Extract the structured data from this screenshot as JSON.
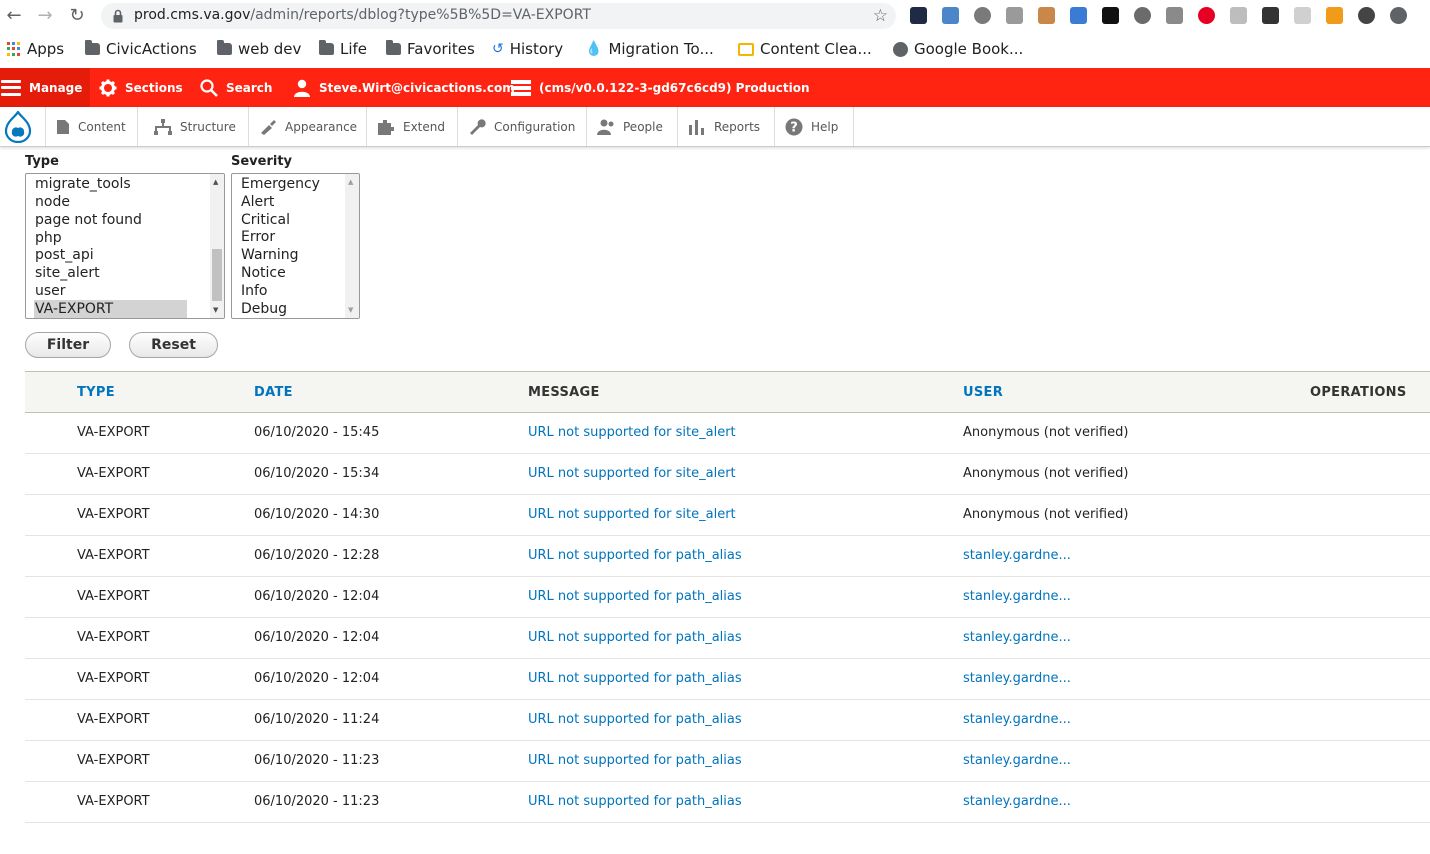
{
  "browser": {
    "url_host": "prod.cms.va.gov",
    "url_path": "/admin/reports/dblog?type%5B%5D=VA-EXPORT",
    "bookmarks": [
      {
        "label": "Apps",
        "icon": "apps-grid-icon"
      },
      {
        "label": "CivicActions",
        "icon": "folder-icon"
      },
      {
        "label": "web dev",
        "icon": "folder-icon"
      },
      {
        "label": "Life",
        "icon": "folder-icon"
      },
      {
        "label": "Favorites",
        "icon": "folder-icon"
      },
      {
        "label": "History",
        "icon": "history-icon"
      },
      {
        "label": "Migration To...",
        "icon": "drupal-drop-icon"
      },
      {
        "label": "Content Clea...",
        "icon": "slides-icon"
      },
      {
        "label": "Google Book...",
        "icon": "globe-icon"
      }
    ]
  },
  "toolbar": {
    "manage": "Manage",
    "sections": "Sections",
    "search": "Search",
    "user": "Steve.Wirt@civicactions.com",
    "environment": "(cms/v0.0.122-3-gd67c6cd9) Production"
  },
  "tray": {
    "items": [
      "Content",
      "Structure",
      "Appearance",
      "Extend",
      "Configuration",
      "People",
      "Reports",
      "Help"
    ]
  },
  "filters": {
    "type_label": "Type",
    "type_options": [
      "migrate_tools",
      "node",
      "page not found",
      "php",
      "post_api",
      "site_alert",
      "user",
      "VA-EXPORT"
    ],
    "type_selected": "VA-EXPORT",
    "severity_label": "Severity",
    "severity_options": [
      "Emergency",
      "Alert",
      "Critical",
      "Error",
      "Warning",
      "Notice",
      "Info",
      "Debug"
    ],
    "filter_button": "Filter",
    "reset_button": "Reset"
  },
  "table": {
    "headers": {
      "type": "TYPE",
      "date": "DATE",
      "message": "MESSAGE",
      "user": "USER",
      "operations": "OPERATIONS"
    },
    "rows": [
      {
        "type": "VA-EXPORT",
        "date": "06/10/2020 - 15:45",
        "message": "URL not supported for site_alert",
        "user": "Anonymous (not verified)",
        "user_link": false
      },
      {
        "type": "VA-EXPORT",
        "date": "06/10/2020 - 15:34",
        "message": "URL not supported for site_alert",
        "user": "Anonymous (not verified)",
        "user_link": false
      },
      {
        "type": "VA-EXPORT",
        "date": "06/10/2020 - 14:30",
        "message": "URL not supported for site_alert",
        "user": "Anonymous (not verified)",
        "user_link": false
      },
      {
        "type": "VA-EXPORT",
        "date": "06/10/2020 - 12:28",
        "message": "URL not supported for path_alias",
        "user": "stanley.gardne...",
        "user_link": true
      },
      {
        "type": "VA-EXPORT",
        "date": "06/10/2020 - 12:04",
        "message": "URL not supported for path_alias",
        "user": "stanley.gardne...",
        "user_link": true
      },
      {
        "type": "VA-EXPORT",
        "date": "06/10/2020 - 12:04",
        "message": "URL not supported for path_alias",
        "user": "stanley.gardne...",
        "user_link": true
      },
      {
        "type": "VA-EXPORT",
        "date": "06/10/2020 - 12:04",
        "message": "URL not supported for path_alias",
        "user": "stanley.gardne...",
        "user_link": true
      },
      {
        "type": "VA-EXPORT",
        "date": "06/10/2020 - 11:24",
        "message": "URL not supported for path_alias",
        "user": "stanley.gardne...",
        "user_link": true
      },
      {
        "type": "VA-EXPORT",
        "date": "06/10/2020 - 11:23",
        "message": "URL not supported for path_alias",
        "user": "stanley.gardne...",
        "user_link": true
      },
      {
        "type": "VA-EXPORT",
        "date": "06/10/2020 - 11:23",
        "message": "URL not supported for path_alias",
        "user": "stanley.gardne...",
        "user_link": true
      }
    ]
  },
  "colors": {
    "toolbar_red": "#ff2311",
    "link_blue": "#0074bd"
  }
}
